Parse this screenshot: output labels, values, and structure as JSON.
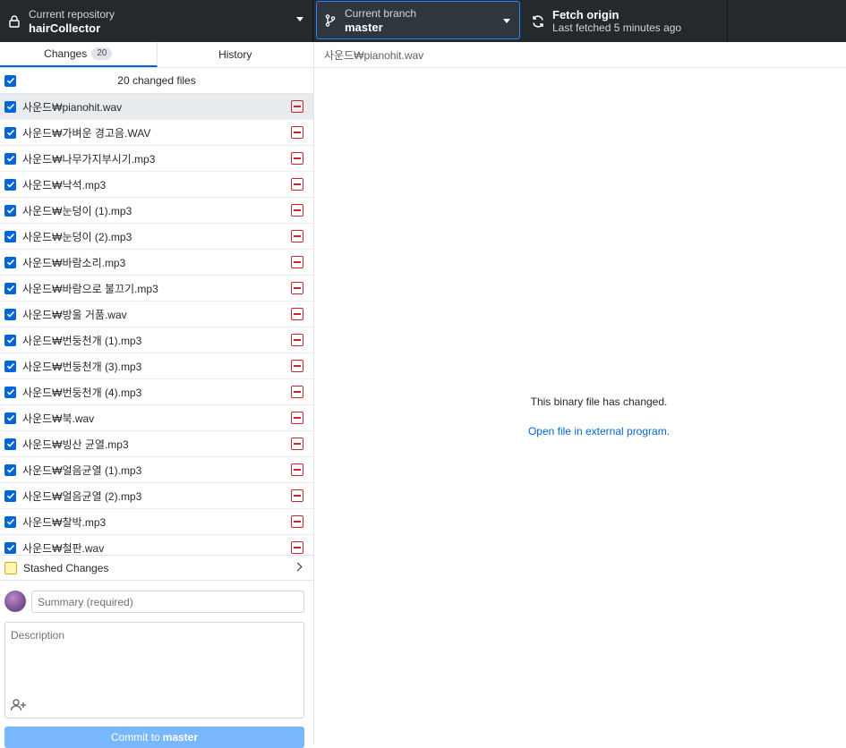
{
  "toolbar": {
    "repository": {
      "label": "Current repository",
      "value": "hairCollector"
    },
    "branch": {
      "label": "Current branch",
      "value": "master"
    },
    "fetch": {
      "label": "Fetch origin",
      "status": "Last fetched 5 minutes ago"
    }
  },
  "tabs": {
    "changes_label": "Changes",
    "changes_count": "20",
    "history_label": "History"
  },
  "changes_header": "20 changed files",
  "files": [
    "사운드₩pianohit.wav",
    "사운드₩가벼운 경고음.WAV",
    "사운드₩나무가지부시기.mp3",
    "사운드₩낙석.mp3",
    "사운드₩눈덩이 (1).mp3",
    "사운드₩눈덩이 (2).mp3",
    "사운드₩바람소리.mp3",
    "사운드₩바람으로 불끄기.mp3",
    "사운드₩방울 거품.wav",
    "사운드₩번둥천개 (1).mp3",
    "사운드₩번둥천개 (3).mp3",
    "사운드₩번둥천개 (4).mp3",
    "사운드₩북.wav",
    "사운드₩빙산 균열.mp3",
    "사운드₩얼음균열 (1).mp3",
    "사운드₩얼음균열 (2).mp3",
    "사운드₩찰박.mp3",
    "사운드₩철판.wav"
  ],
  "stash_label": "Stashed Changes",
  "commit": {
    "summary_placeholder": "Summary (required)",
    "description_placeholder": "Description",
    "button_prefix": "Commit to",
    "button_branch": "master"
  },
  "diff": {
    "path": "사운드₩pianohit.wav",
    "message": "This binary file has changed.",
    "link": "Open file in external program."
  },
  "colors": {
    "toolbar_bg": "#24292e",
    "accent": "#0366d6",
    "deleted": "#cb2431",
    "commit_button": "#79b8ff"
  }
}
